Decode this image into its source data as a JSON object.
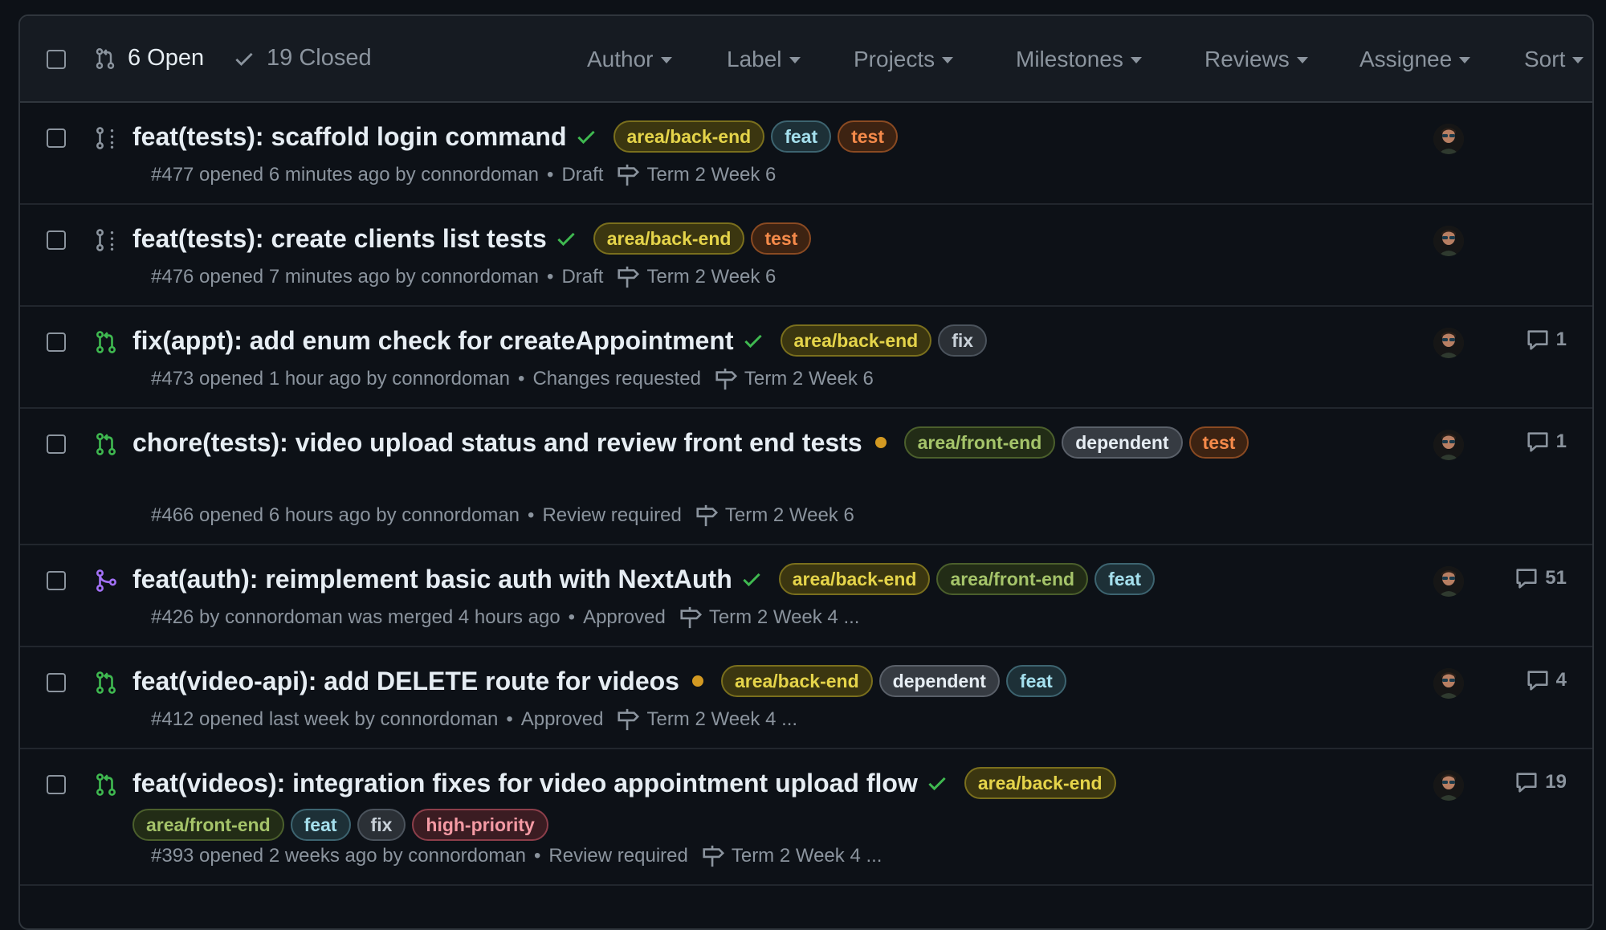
{
  "header": {
    "open_label": "6 Open",
    "closed_label": "19 Closed",
    "filters": [
      "Author",
      "Label",
      "Projects",
      "Milestones",
      "Reviews",
      "Assignee",
      "Sort"
    ]
  },
  "label_colors": {
    "area/back-end": {
      "text": "#e5d44a",
      "bg": "#3b3610",
      "border": "#7a6f1d"
    },
    "area/front-end": {
      "text": "#a5c46a",
      "bg": "#222c16",
      "border": "#4b5f2c"
    },
    "feat": {
      "text": "#a5e0ee",
      "bg": "#1d3037",
      "border": "#3d6470"
    },
    "test": {
      "text": "#f58a4a",
      "bg": "#3d2312",
      "border": "#8a4a22"
    },
    "fix": {
      "text": "#c9d1d9",
      "bg": "#2b3036",
      "border": "#4b535c"
    },
    "dependent": {
      "text": "#e6edf3",
      "bg": "#363b42",
      "border": "#5a6069"
    },
    "high-priority": {
      "text": "#f49aa4",
      "bg": "#3b1c22",
      "border": "#8c3e4a"
    }
  },
  "pulls": [
    {
      "kind": "draft",
      "title": "feat(tests): scaffold login command",
      "check": "success",
      "labels": [
        "area/back-end",
        "feat",
        "test"
      ],
      "meta": "#477 opened 6 minutes ago by connordoman",
      "review": "Draft",
      "milestone": "Term 2 Week 6",
      "comments": null
    },
    {
      "kind": "draft",
      "title": "feat(tests): create clients list tests",
      "check": "success",
      "labels": [
        "area/back-end",
        "test"
      ],
      "meta": "#476 opened 7 minutes ago by connordoman",
      "review": "Draft",
      "milestone": "Term 2 Week 6",
      "comments": null
    },
    {
      "kind": "open",
      "title": "fix(appt): add enum check for createAppointment",
      "check": "success",
      "labels": [
        "area/back-end",
        "fix"
      ],
      "meta": "#473 opened 1 hour ago by connordoman",
      "review": "Changes requested",
      "milestone": "Term 2 Week 6",
      "comments": "1"
    },
    {
      "kind": "open",
      "title": "chore(tests): video upload status and review front end tests",
      "check": "pending",
      "labels": [
        "area/front-end",
        "dependent",
        "test"
      ],
      "meta": "#466 opened 6 hours ago by connordoman",
      "review": "Review required",
      "milestone": "Term 2 Week 6",
      "comments": "1"
    },
    {
      "kind": "merged",
      "title": "feat(auth): reimplement basic auth with NextAuth",
      "check": "success",
      "labels": [
        "area/back-end",
        "area/front-end",
        "feat"
      ],
      "meta": "#426 by connordoman was merged 4 hours ago",
      "review": "Approved",
      "milestone": "Term 2 Week 4 ...",
      "comments": "51"
    },
    {
      "kind": "open",
      "title": "feat(video-api): add DELETE route for videos",
      "check": "pending",
      "labels": [
        "area/back-end",
        "dependent",
        "feat"
      ],
      "meta": "#412 opened last week by connordoman",
      "review": "Approved",
      "milestone": "Term 2 Week 4 ...",
      "comments": "4"
    },
    {
      "kind": "open",
      "title": "feat(videos): integration fixes for video appointment upload flow",
      "check": "success",
      "labels": [
        "area/back-end",
        "area/front-end",
        "feat",
        "fix",
        "high-priority"
      ],
      "meta": "#393 opened 2 weeks ago by connordoman",
      "review": "Review required",
      "milestone": "Term 2 Week 4 ...",
      "comments": "19"
    }
  ]
}
